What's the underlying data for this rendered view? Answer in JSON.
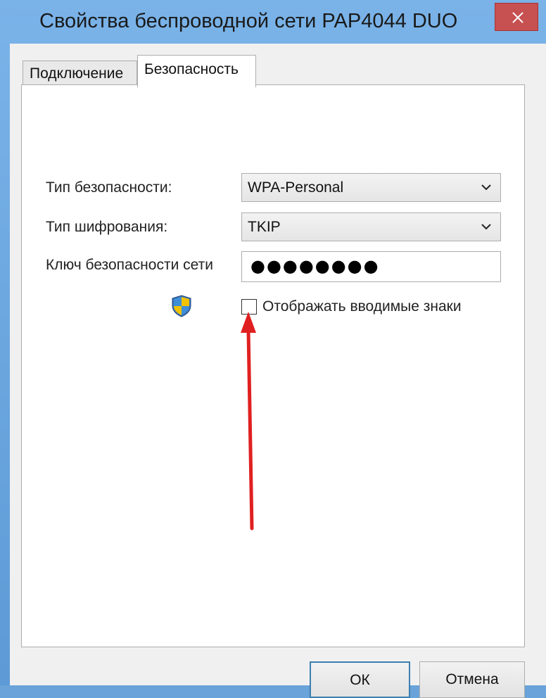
{
  "window": {
    "title": "Свойства беспроводной сети PAP4044 DUO",
    "close_icon": "close-icon"
  },
  "tabs": [
    {
      "label": "Подключение",
      "active": false
    },
    {
      "label": "Безопасность",
      "active": true
    }
  ],
  "security": {
    "security_type_label": "Тип безопасности:",
    "security_type_value": "WPA-Personal",
    "encryption_type_label": "Тип шифрования:",
    "encryption_type_value": "TKIP",
    "network_key_label": "Ключ безопасности сети",
    "network_key_value": "●●●●●●●●",
    "show_chars_label": "Отображать вводимые знаки",
    "show_chars_checked": false
  },
  "buttons": {
    "ok_label": "ОК",
    "cancel_label": "Отмена"
  },
  "colors": {
    "title_bar": "#6aa3d9",
    "close_button": "#c75050",
    "annotation_arrow": "#e02020"
  }
}
